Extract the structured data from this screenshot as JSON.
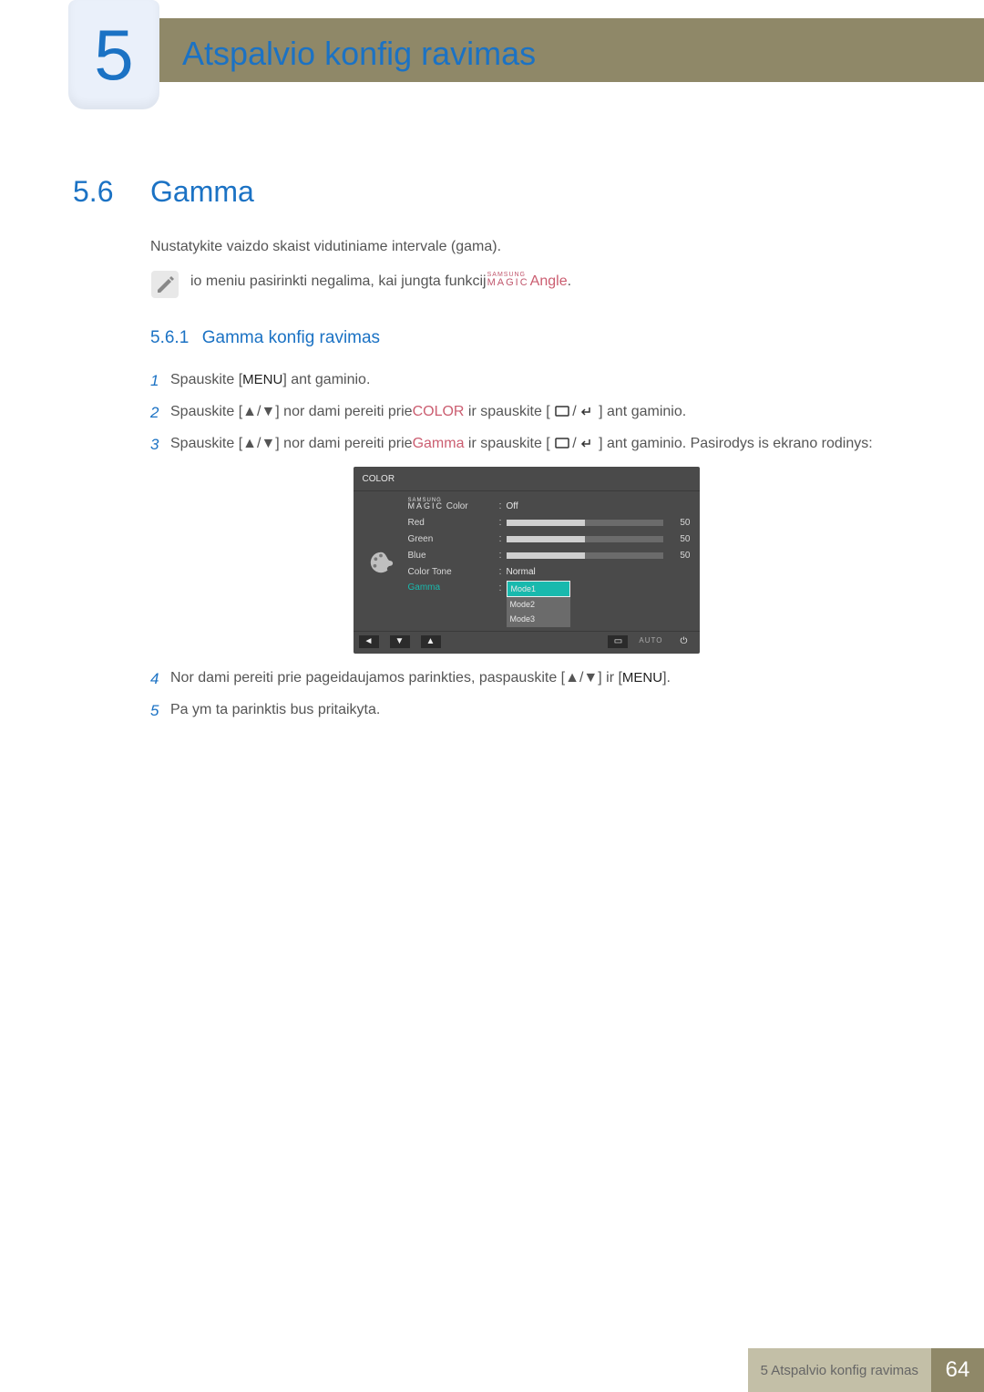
{
  "chapter": {
    "number": "5",
    "title": "Atspalvio konfig  ravimas"
  },
  "section": {
    "number": "5.6",
    "title": "Gamma"
  },
  "intro": "Nustatykite vaizdo skaist  vidutiniame intervale (gama).",
  "note": {
    "prefix": "io meniu pasirinkti negalima, kai  jungta funkcij",
    "brand_top": "SAMSUNG",
    "brand_bot": "MAGIC",
    "suffix": "Angle"
  },
  "subsection": {
    "number": "5.6.1",
    "title": "Gamma konfig  ravimas"
  },
  "steps": {
    "s1": {
      "num": "1",
      "a": "Spauskite [",
      "menu": "MENU",
      "b": "] ant gaminio."
    },
    "s2": {
      "num": "2",
      "a": "Spauskite [",
      "arrows": "▲/▼",
      "b": "] nor dami pereiti prie",
      "kw": "COLOR",
      "c": " ir spauskite [",
      "d": "] ant gaminio."
    },
    "s3": {
      "num": "3",
      "a": "Spauskite [",
      "arrows": "▲/▼",
      "b": "] nor dami pereiti prie",
      "kw": "Gamma",
      "c": " ir spauskite [",
      "d": "] ant gaminio. Pasirodys  is ekrano rodinys:"
    },
    "s4": {
      "num": "4",
      "a": "Nor dami pereiti prie pageidaujamos parinkties, paspauskite [",
      "arrows": "▲/▼",
      "b": "] ir [",
      "menu": "MENU",
      "c": "]."
    },
    "s5": {
      "num": "5",
      "a": "Pa ym ta parinktis bus pritaikyta."
    }
  },
  "osd": {
    "title": "COLOR",
    "brand_top": "SAMSUNG",
    "brand_bot": "MAGIC",
    "magic_color_label": " Color",
    "magic_color_value": "Off",
    "red": {
      "label": "Red",
      "value": "50"
    },
    "green": {
      "label": "Green",
      "value": "50"
    },
    "blue": {
      "label": "Blue",
      "value": "50"
    },
    "color_tone": {
      "label": "Color Tone",
      "value": "Normal"
    },
    "gamma": {
      "label": "Gamma",
      "mode1": "Mode1",
      "mode2": "Mode2",
      "mode3": "Mode3"
    },
    "nav": {
      "auto": "AUTO"
    }
  },
  "footer": {
    "text": "5 Atspalvio konfig  ravimas",
    "page": "64"
  },
  "chart_data": {
    "type": "bar",
    "title": "COLOR OSD sliders",
    "categories": [
      "Red",
      "Green",
      "Blue"
    ],
    "values": [
      50,
      50,
      50
    ],
    "ylim": [
      0,
      100
    ]
  }
}
